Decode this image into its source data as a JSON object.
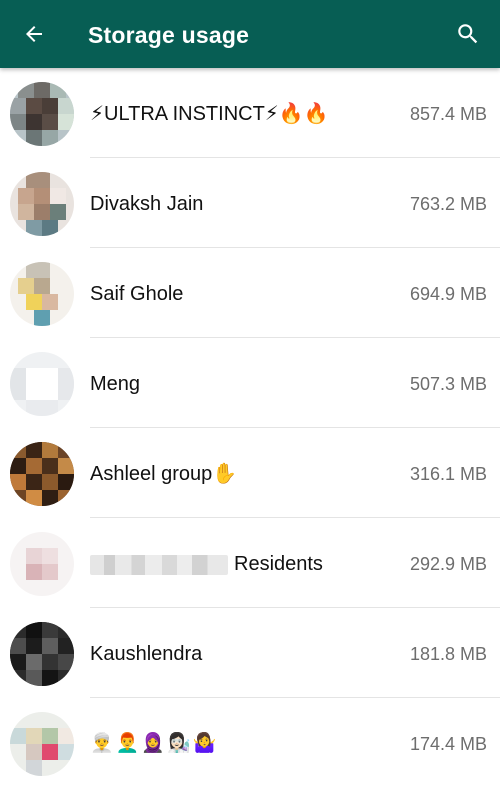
{
  "appbar": {
    "title": "Storage usage",
    "color": "#075e54",
    "back_icon": "arrow-back-icon",
    "search_icon": "search-icon"
  },
  "chats": [
    {
      "name": "⚡ULTRA INSTINCT⚡🔥🔥",
      "size": "857.4 MB"
    },
    {
      "name": "Divaksh Jain",
      "size": "763.2 MB"
    },
    {
      "name": "Saif Ghole",
      "size": "694.9 MB"
    },
    {
      "name": "Meng",
      "size": "507.3 MB"
    },
    {
      "name": "Ashleel group✋",
      "size": "316.1 MB"
    },
    {
      "name": "Residents",
      "size": "292.9 MB"
    },
    {
      "name": "Kaushlendra",
      "size": "181.8 MB"
    },
    {
      "name": "👳‍♂️👨‍🦰🧕👩🏻‍🔬🤷‍♀️",
      "size": "174.4 MB"
    }
  ]
}
